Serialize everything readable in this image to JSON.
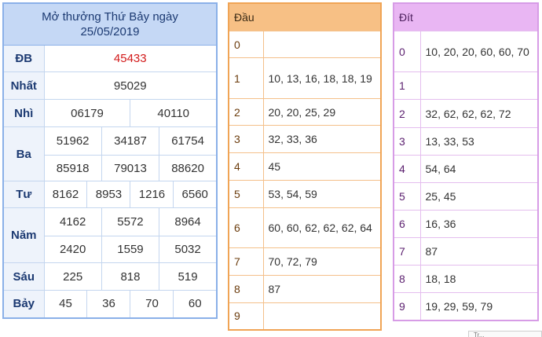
{
  "results": {
    "title_line1": "Mở thưởng Thứ Bảy ngày",
    "title_line2": "25/05/2019",
    "db": {
      "label": "ĐB",
      "value": "45433"
    },
    "nhat": {
      "label": "Nhất",
      "value": "95029"
    },
    "nhi": {
      "label": "Nhì",
      "values": [
        "06179",
        "40110"
      ]
    },
    "ba": {
      "label": "Ba",
      "values": [
        "51962",
        "34187",
        "61754",
        "85918",
        "79013",
        "88620"
      ]
    },
    "tu": {
      "label": "Tư",
      "values": [
        "8162",
        "8953",
        "1216",
        "6560"
      ]
    },
    "nam": {
      "label": "Năm",
      "values": [
        "4162",
        "5572",
        "8964",
        "2420",
        "1559",
        "5032"
      ]
    },
    "sau": {
      "label": "Sáu",
      "values": [
        "225",
        "818",
        "519"
      ]
    },
    "bay": {
      "label": "Bảy",
      "values": [
        "45",
        "36",
        "70",
        "60"
      ]
    }
  },
  "dau": {
    "header": "Đầu",
    "rows": [
      {
        "key": "0",
        "values": ""
      },
      {
        "key": "1",
        "values": "10, 13, 16, 18, 18, 19"
      },
      {
        "key": "2",
        "values": "20, 20, 25, 29"
      },
      {
        "key": "3",
        "values": "32, 33, 36"
      },
      {
        "key": "4",
        "values": "45"
      },
      {
        "key": "5",
        "values": "53, 54, 59"
      },
      {
        "key": "6",
        "values": "60, 60, 62, 62, 62, 64"
      },
      {
        "key": "7",
        "values": "70, 72, 79"
      },
      {
        "key": "8",
        "values": "87"
      },
      {
        "key": "9",
        "values": ""
      }
    ]
  },
  "dit": {
    "header": "Đít",
    "rows": [
      {
        "key": "0",
        "values": "10, 20, 20, 60, 60, 70"
      },
      {
        "key": "1",
        "values": ""
      },
      {
        "key": "2",
        "values": "32, 62, 62, 62, 72"
      },
      {
        "key": "3",
        "values": "13, 33, 53"
      },
      {
        "key": "4",
        "values": "54, 64"
      },
      {
        "key": "5",
        "values": "25, 45"
      },
      {
        "key": "6",
        "values": "16, 36"
      },
      {
        "key": "7",
        "values": "87"
      },
      {
        "key": "8",
        "values": "18, 18"
      },
      {
        "key": "9",
        "values": "19, 29, 59, 79"
      }
    ]
  },
  "corner_widget": {
    "text": "Tr..."
  },
  "colors": {
    "results_border": "#8ab0e8",
    "dau_border": "#f0a455",
    "dit_border": "#d79ce6",
    "special_prize": "#d21a1a"
  }
}
